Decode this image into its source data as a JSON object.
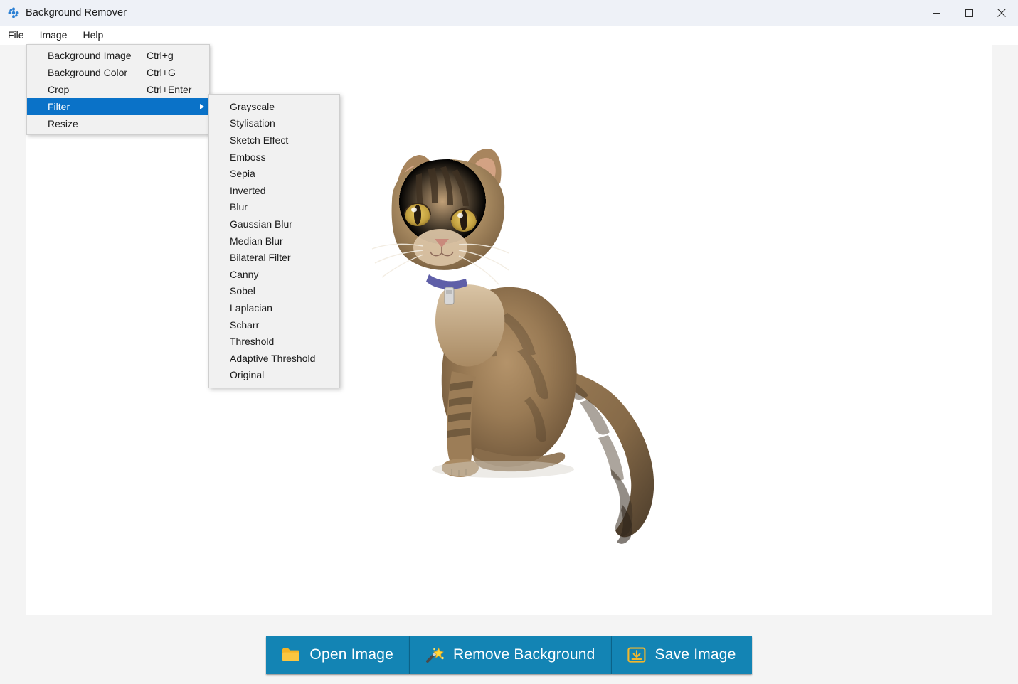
{
  "window": {
    "title": "Background Remover",
    "icon": "app-gear-icon",
    "controls": {
      "minimize": "—",
      "maximize": "□",
      "close": "✕"
    }
  },
  "menubar": {
    "items": [
      {
        "label": "File",
        "name": "menubar-item-file"
      },
      {
        "label": "Image",
        "name": "menubar-item-image"
      },
      {
        "label": "Help",
        "name": "menubar-item-help"
      }
    ]
  },
  "image_menu": {
    "open": true,
    "items": [
      {
        "label": "Background Image",
        "accel": "Ctrl+g",
        "selected": false,
        "submenu": false
      },
      {
        "label": "Background Color",
        "accel": "Ctrl+G",
        "selected": false,
        "submenu": false
      },
      {
        "label": "Crop",
        "accel": "Ctrl+Enter",
        "selected": false,
        "submenu": false
      },
      {
        "label": "Filter",
        "accel": "",
        "selected": true,
        "submenu": true
      },
      {
        "label": "Resize",
        "accel": "",
        "selected": false,
        "submenu": false
      }
    ]
  },
  "filter_submenu": {
    "open": true,
    "items": [
      {
        "label": "Grayscale"
      },
      {
        "label": "Stylisation"
      },
      {
        "label": "Sketch Effect"
      },
      {
        "label": "Emboss"
      },
      {
        "label": "Sepia"
      },
      {
        "label": "Inverted"
      },
      {
        "label": "Blur"
      },
      {
        "label": "Gaussian Blur"
      },
      {
        "label": "Median Blur"
      },
      {
        "label": "Bilateral Filter"
      },
      {
        "label": "Canny"
      },
      {
        "label": "Sobel"
      },
      {
        "label": "Laplacian"
      },
      {
        "label": "Scharr"
      },
      {
        "label": "Threshold"
      },
      {
        "label": "Adaptive Threshold"
      },
      {
        "label": "Original"
      }
    ]
  },
  "canvas": {
    "content_description": "tabby cat sitting with long tail, background removed",
    "background_color": "#ffffff"
  },
  "actions": {
    "buttons": [
      {
        "label": "Open Image",
        "icon": "folder-icon",
        "name": "open-image-button"
      },
      {
        "label": "Remove Background",
        "icon": "magic-wand-icon",
        "name": "remove-background-button"
      },
      {
        "label": "Save Image",
        "icon": "save-folder-icon",
        "name": "save-image-button"
      }
    ]
  },
  "colors": {
    "titlebar_bg": "#eef1f7",
    "menu_bg": "#f1f1f1",
    "menu_highlight": "#0a72c8",
    "button_bg": "#1384b4",
    "button_text": "#ffffff",
    "app_bg": "#f4f4f4",
    "canvas_bg": "#ffffff",
    "folder_icon": "#f5b426"
  }
}
